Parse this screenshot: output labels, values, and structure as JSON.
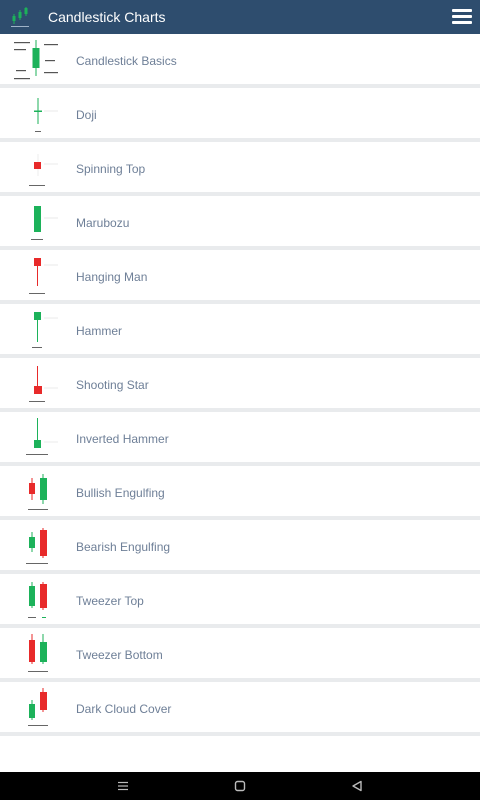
{
  "app": {
    "title": "Candlestick Charts",
    "logo_icon": "candlestick-logo-icon",
    "menu_icon": "hamburger-menu-icon"
  },
  "colors": {
    "appbar": "#2e4d6e",
    "label": "#6e7f97",
    "bullish": "#1cb25a",
    "bearish": "#e82a2a",
    "divider": "#e9ebed"
  },
  "list": {
    "items": [
      {
        "label": "Candlestick Basics",
        "icon": "candlestick-basics-icon"
      },
      {
        "label": "Doji",
        "icon": "doji-icon"
      },
      {
        "label": "Spinning Top",
        "icon": "spinning-top-icon"
      },
      {
        "label": "Marubozu",
        "icon": "marubozu-icon"
      },
      {
        "label": "Hanging Man",
        "icon": "hanging-man-icon"
      },
      {
        "label": "Hammer",
        "icon": "hammer-icon"
      },
      {
        "label": "Shooting Star",
        "icon": "shooting-star-icon"
      },
      {
        "label": "Inverted Hammer",
        "icon": "inverted-hammer-icon"
      },
      {
        "label": "Bullish Engulfing",
        "icon": "bullish-engulfing-icon"
      },
      {
        "label": "Bearish Engulfing",
        "icon": "bearish-engulfing-icon"
      },
      {
        "label": "Tweezer Top",
        "icon": "tweezer-top-icon"
      },
      {
        "label": "Tweezer Bottom",
        "icon": "tweezer-bottom-icon"
      },
      {
        "label": "Dark Cloud Cover",
        "icon": "dark-cloud-cover-icon"
      }
    ]
  },
  "system_nav": {
    "recents_icon": "recents-icon",
    "home_icon": "home-icon",
    "back_icon": "back-icon"
  }
}
